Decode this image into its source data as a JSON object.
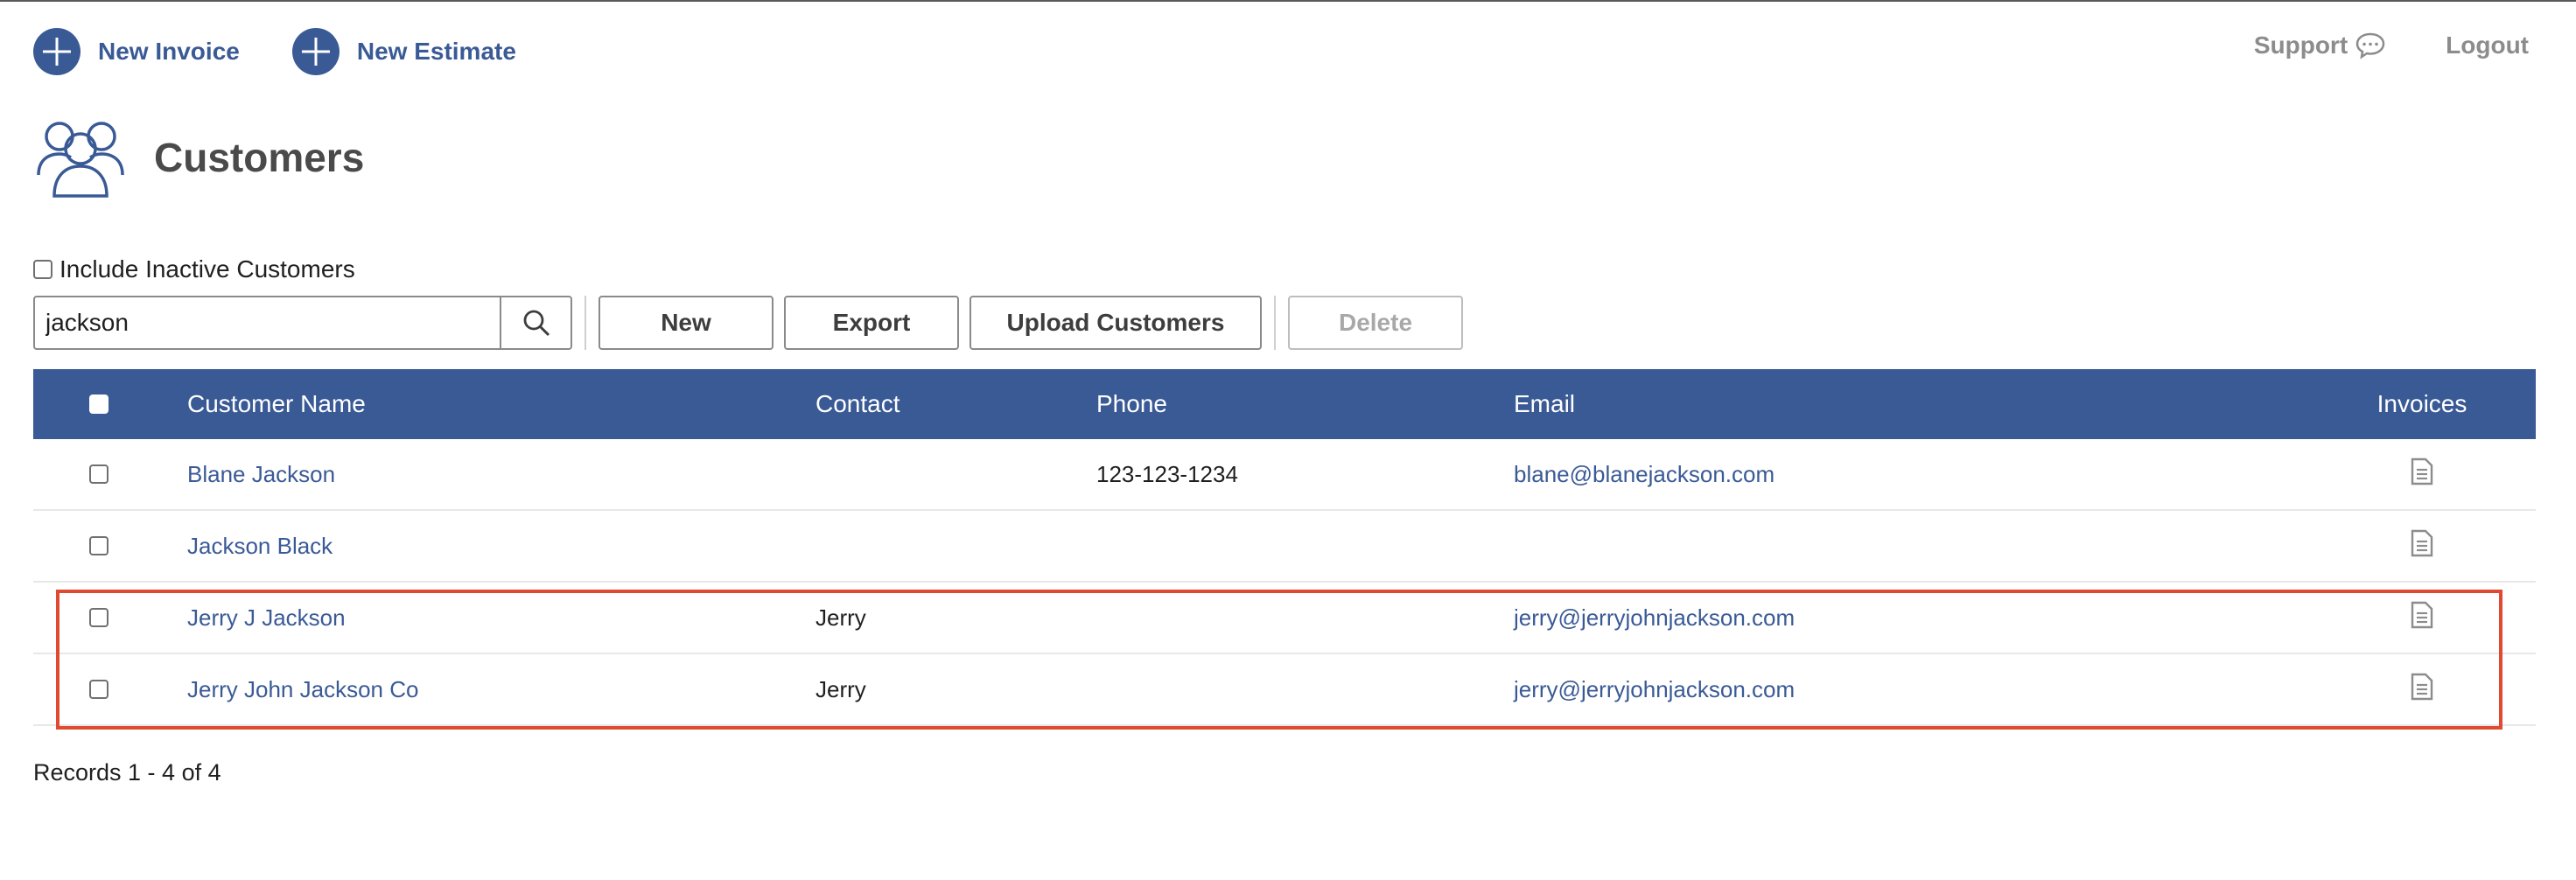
{
  "topbar": {
    "new_invoice_label": "New Invoice",
    "new_estimate_label": "New Estimate",
    "support_label": "Support",
    "logout_label": "Logout"
  },
  "page": {
    "title": "Customers",
    "icon": "customers-group-icon"
  },
  "filters": {
    "include_inactive_label": "Include Inactive Customers",
    "include_inactive_checked": false,
    "search_value": "jackson"
  },
  "toolbar": {
    "new_label": "New",
    "export_label": "Export",
    "upload_label": "Upload Customers",
    "delete_label": "Delete"
  },
  "table": {
    "headers": {
      "name": "Customer Name",
      "contact": "Contact",
      "phone": "Phone",
      "email": "Email",
      "invoices": "Invoices"
    },
    "rows": [
      {
        "name": "Blane Jackson",
        "contact": "",
        "phone": "123-123-1234",
        "email": "blane@blanejackson.com"
      },
      {
        "name": "Jackson Black",
        "contact": "",
        "phone": "",
        "email": ""
      },
      {
        "name": "Jerry J Jackson",
        "contact": "Jerry",
        "phone": "",
        "email": "jerry@jerryjohnjackson.com"
      },
      {
        "name": "Jerry John Jackson Co",
        "contact": "Jerry",
        "phone": "",
        "email": "jerry@jerryjohnjackson.com"
      }
    ]
  },
  "footer": {
    "records_text": "Records 1 - 4 of 4"
  },
  "colors": {
    "brand_blue": "#3a5a96",
    "highlight_red": "#e04a30",
    "muted_gray": "#8c8c8c"
  }
}
